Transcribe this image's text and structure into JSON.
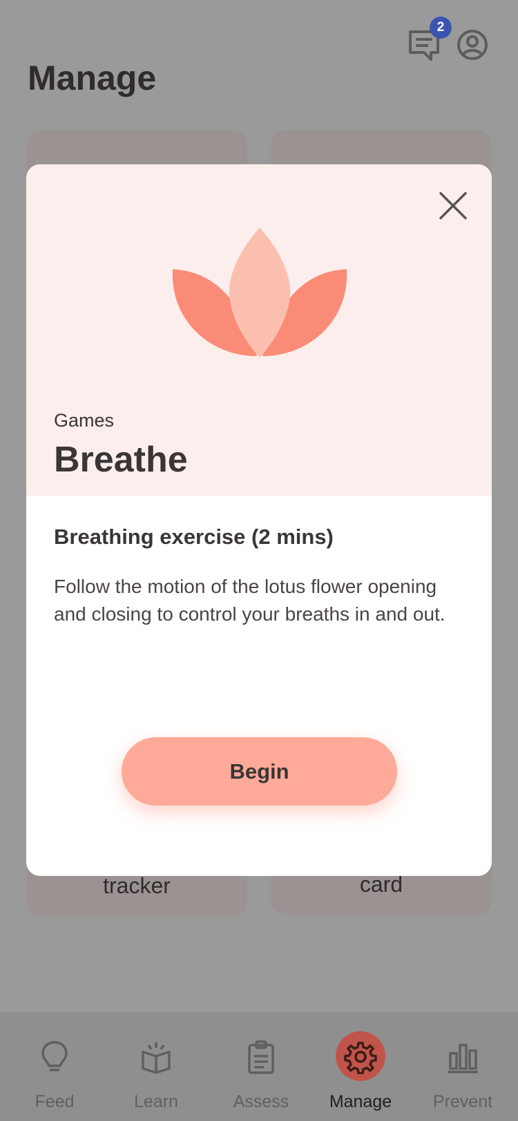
{
  "header": {
    "title": "Manage",
    "messages_badge": "2",
    "icons": [
      "chat-icon",
      "profile-icon"
    ]
  },
  "background_cards": {
    "left_label": "tracker",
    "right_label": "card"
  },
  "modal": {
    "category": "Games",
    "title": "Breathe",
    "subtitle": "Breathing exercise (2 mins)",
    "description": "Follow the motion of the lotus flower opening and closing to control your breaths in and out.",
    "begin_label": "Begin",
    "icons": [
      "close-icon",
      "lotus-icon"
    ]
  },
  "tabbar": {
    "items": [
      {
        "label": "Feed",
        "icon": "lightbulb-icon"
      },
      {
        "label": "Learn",
        "icon": "book-icon"
      },
      {
        "label": "Assess",
        "icon": "clipboard-icon"
      },
      {
        "label": "Manage",
        "icon": "gear-icon"
      },
      {
        "label": "Prevent",
        "icon": "bar-chart-icon"
      }
    ],
    "active": "Manage"
  },
  "colors": {
    "overlay": "#9a9a9a",
    "hero_background": "#fbeeec",
    "accent": "#ffaa98",
    "lotus_outer": "#fa8b76",
    "lotus_inner": "#fbbfb0",
    "badge": "#3a55b0",
    "active_tab": "#c0544a"
  }
}
